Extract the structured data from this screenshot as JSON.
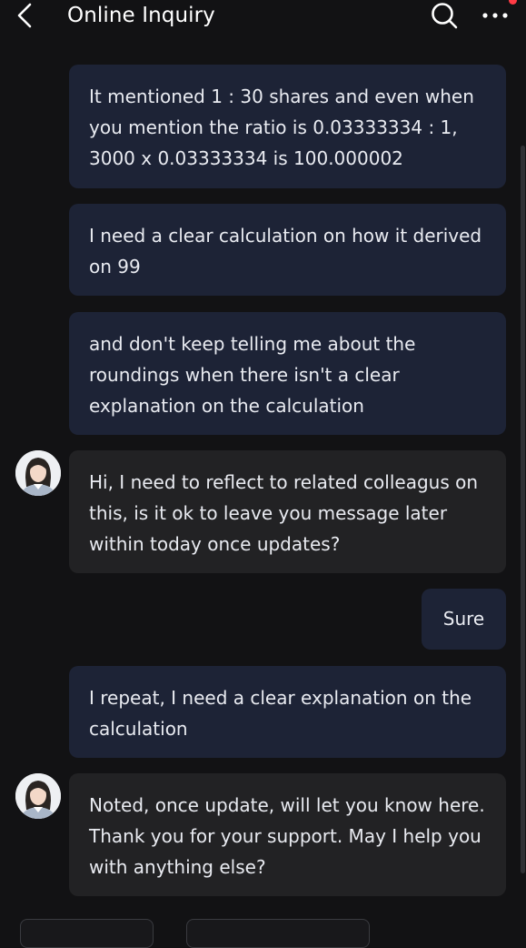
{
  "header": {
    "title": "Online Inquiry",
    "back_icon": "chevron-left-icon",
    "search_icon": "search-icon",
    "more_icon": "more-icon"
  },
  "messages": [
    {
      "sender": "user",
      "text": "It mentioned 1 : 30 shares and even when you mention the ratio is 0.03333334 : 1, 3000 x 0.03333334 is 100.000002"
    },
    {
      "sender": "user",
      "text": "I need a clear calculation on how it derived on 99"
    },
    {
      "sender": "user",
      "text": "and don't keep telling me about the roundings when there isn't a clear explanation on the calculation"
    },
    {
      "sender": "agent",
      "text": "Hi, I need to reflect to related colleagus on this, is it ok to leave you message later within today once updates?"
    },
    {
      "sender": "user",
      "text": "Sure"
    },
    {
      "sender": "user",
      "text": "I repeat, I need a clear explanation on the calculation"
    },
    {
      "sender": "agent",
      "text": "Noted, once update, will let you know here. Thank you for your support. May I help you with anything else?"
    }
  ],
  "colors": {
    "background": "#121214",
    "user_bubble": "#1d2336",
    "agent_bubble": "#222224",
    "notification_dot": "#ff3b45"
  }
}
